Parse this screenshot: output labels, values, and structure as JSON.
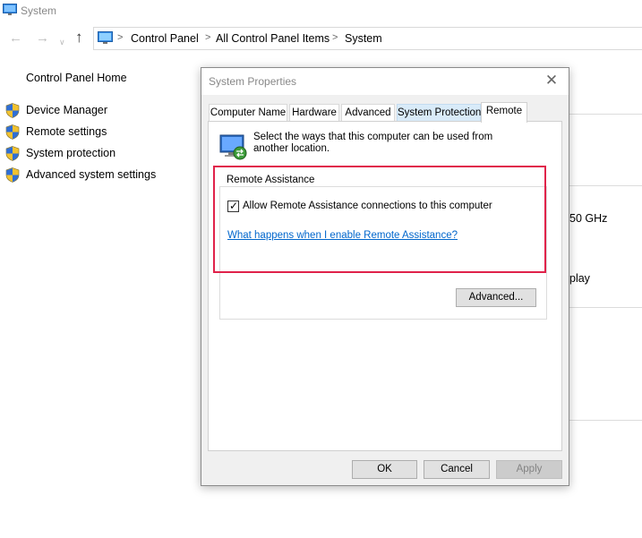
{
  "window": {
    "title": "System"
  },
  "address_bar": {
    "crumbs": [
      "Control Panel",
      "All Control Panel Items",
      "System"
    ],
    "separator": ">"
  },
  "nav_glyphs": {
    "back": "←",
    "forward": "→",
    "recent": "∨",
    "up": "↑"
  },
  "left_nav": {
    "home": "Control Panel Home",
    "items": [
      {
        "label": "Device Manager",
        "icon": "uac-shield-icon"
      },
      {
        "label": "Remote settings",
        "icon": "uac-shield-icon"
      },
      {
        "label": "System protection",
        "icon": "uac-shield-icon"
      },
      {
        "label": "Advanced system settings",
        "icon": "uac-shield-icon"
      }
    ]
  },
  "background_fragments": {
    "cpu_speed": "50 GHz",
    "display": "play"
  },
  "dialog": {
    "title": "System Properties",
    "close_glyph": "✕",
    "tabs": [
      {
        "label": "Computer Name",
        "state": "normal"
      },
      {
        "label": "Hardware",
        "state": "normal"
      },
      {
        "label": "Advanced",
        "state": "normal"
      },
      {
        "label": "System Protection",
        "state": "hover"
      },
      {
        "label": "Remote",
        "state": "selected"
      }
    ],
    "remote_tab": {
      "description": "Select the ways that this computer can be used from another location.",
      "remote_assistance": {
        "group_title": "Remote Assistance",
        "allow_checkbox": {
          "label": "Allow Remote Assistance connections to this computer",
          "checked": true,
          "tick": "✓"
        },
        "help_link": "What happens when I enable Remote Assistance?",
        "advanced_button": "Advanced..."
      }
    },
    "buttons": {
      "ok": "OK",
      "cancel": "Cancel",
      "apply": "Apply"
    }
  },
  "colors": {
    "highlight_border": "#e0224a",
    "link": "#0066cc",
    "tab_hover": "#d9ebf9",
    "disabled_button_text": "#838383"
  }
}
